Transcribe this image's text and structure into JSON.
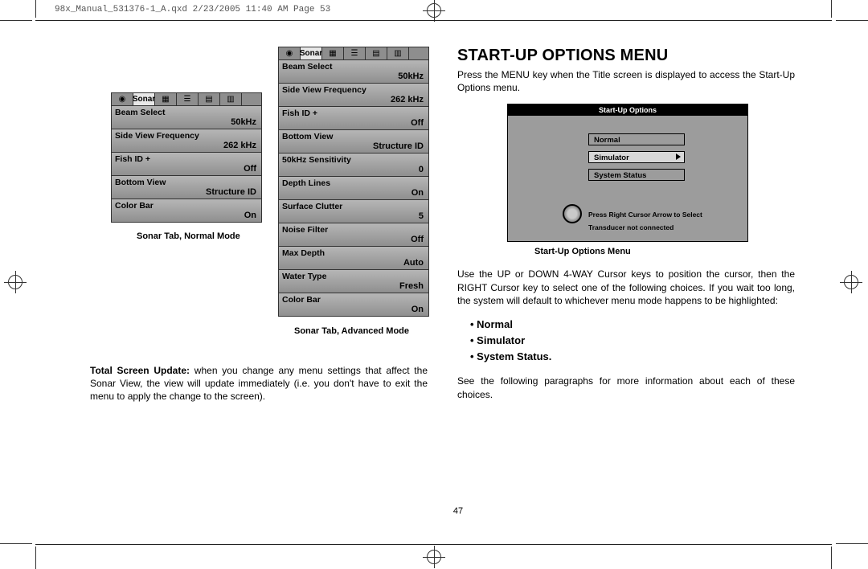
{
  "header_line": "98x_Manual_531376-1_A.qxd  2/23/2005  11:40 AM  Page 53",
  "page_number": "47",
  "left": {
    "caption_normal": "Sonar Tab, Normal Mode",
    "caption_advanced": "Sonar Tab, Advanced Mode",
    "tab_label": "Sonar",
    "normal_rows": [
      {
        "label": "Beam Select",
        "value": "50kHz"
      },
      {
        "label": "Side View Frequency",
        "value": "262 kHz"
      },
      {
        "label": "Fish ID +",
        "value": "Off"
      },
      {
        "label": "Bottom View",
        "value": "Structure ID"
      },
      {
        "label": "Color Bar",
        "value": "On"
      }
    ],
    "advanced_rows": [
      {
        "label": "Beam Select",
        "value": "50kHz"
      },
      {
        "label": "Side View Frequency",
        "value": "262 kHz"
      },
      {
        "label": "Fish ID +",
        "value": "Off"
      },
      {
        "label": "Bottom View",
        "value": "Structure ID"
      },
      {
        "label": "50kHz Sensitivity",
        "value": "0"
      },
      {
        "label": "Depth Lines",
        "value": "On"
      },
      {
        "label": "Surface Clutter",
        "value": "5"
      },
      {
        "label": "Noise Filter",
        "value": "Off"
      },
      {
        "label": "Max Depth",
        "value": "Auto"
      },
      {
        "label": "Water Type",
        "value": "Fresh"
      },
      {
        "label": "Color Bar",
        "value": "On"
      }
    ],
    "para_bold": "Total Screen Update:",
    "para_rest": " when you change any menu settings that affect the Sonar View, the view will update immediately (i.e. you don't have to exit the menu to apply the change to the screen)."
  },
  "right": {
    "heading": "START-UP OPTIONS MENU",
    "intro": "Press the MENU key when the Title screen is displayed to access the Start-Up Options menu.",
    "startup": {
      "title": "Start-Up Options",
      "options": [
        "Normal",
        "Simulator",
        "System Status"
      ],
      "selected_index": 1,
      "hint1": "Press Right Cursor Arrow to Select",
      "hint2": "Transducer not connected",
      "caption": "Start-Up Options Menu"
    },
    "para2": "Use the UP or DOWN 4-WAY Cursor keys to position the cursor, then the RIGHT Cursor key to select one of the following choices. If you wait too long, the system will default to whichever menu mode happens to be highlighted:",
    "bullets": [
      "Normal",
      "Simulator",
      "System Status."
    ],
    "para3": "See the following paragraphs for more information about each of these choices."
  }
}
